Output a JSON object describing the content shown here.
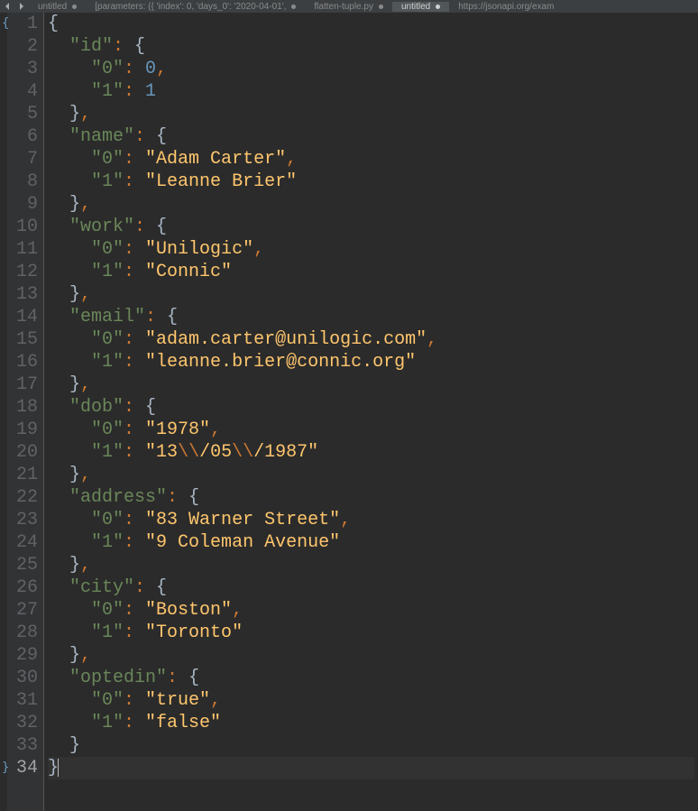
{
  "tabs": [
    {
      "label": "untitled",
      "modified": true,
      "active": false
    },
    {
      "label": "[parameters: ({ 'index': 0, 'days_0': '2020-04-01',",
      "modified": true,
      "active": false
    },
    {
      "label": "flatten-tuple.py",
      "modified": true,
      "active": false
    },
    {
      "label": "untitled",
      "modified": true,
      "active": true
    },
    {
      "label": "https://jsonapi.org/exam",
      "modified": false,
      "active": false
    }
  ],
  "code": {
    "lines": [
      [
        [
          "brace",
          "{"
        ]
      ],
      [
        [
          "sp",
          "  "
        ],
        [
          "key",
          "\"id\""
        ],
        [
          "punc",
          ": "
        ],
        [
          "brace",
          "{"
        ]
      ],
      [
        [
          "sp",
          "    "
        ],
        [
          "key",
          "\"0\""
        ],
        [
          "punc",
          ": "
        ],
        [
          "num",
          "0"
        ],
        [
          "punc",
          ","
        ]
      ],
      [
        [
          "sp",
          "    "
        ],
        [
          "key",
          "\"1\""
        ],
        [
          "punc",
          ": "
        ],
        [
          "num",
          "1"
        ]
      ],
      [
        [
          "sp",
          "  "
        ],
        [
          "brace",
          "}"
        ],
        [
          "punc",
          ","
        ]
      ],
      [
        [
          "sp",
          "  "
        ],
        [
          "key",
          "\"name\""
        ],
        [
          "punc",
          ": "
        ],
        [
          "brace",
          "{"
        ]
      ],
      [
        [
          "sp",
          "    "
        ],
        [
          "key",
          "\"0\""
        ],
        [
          "punc",
          ": "
        ],
        [
          "str",
          "\"Adam Carter\""
        ],
        [
          "punc",
          ","
        ]
      ],
      [
        [
          "sp",
          "    "
        ],
        [
          "key",
          "\"1\""
        ],
        [
          "punc",
          ": "
        ],
        [
          "str",
          "\"Leanne Brier\""
        ]
      ],
      [
        [
          "sp",
          "  "
        ],
        [
          "brace",
          "}"
        ],
        [
          "punc",
          ","
        ]
      ],
      [
        [
          "sp",
          "  "
        ],
        [
          "key",
          "\"work\""
        ],
        [
          "punc",
          ": "
        ],
        [
          "brace",
          "{"
        ]
      ],
      [
        [
          "sp",
          "    "
        ],
        [
          "key",
          "\"0\""
        ],
        [
          "punc",
          ": "
        ],
        [
          "str",
          "\"Unilogic\""
        ],
        [
          "punc",
          ","
        ]
      ],
      [
        [
          "sp",
          "    "
        ],
        [
          "key",
          "\"1\""
        ],
        [
          "punc",
          ": "
        ],
        [
          "str",
          "\"Connic\""
        ]
      ],
      [
        [
          "sp",
          "  "
        ],
        [
          "brace",
          "}"
        ],
        [
          "punc",
          ","
        ]
      ],
      [
        [
          "sp",
          "  "
        ],
        [
          "key",
          "\"email\""
        ],
        [
          "punc",
          ": "
        ],
        [
          "brace",
          "{"
        ]
      ],
      [
        [
          "sp",
          "    "
        ],
        [
          "key",
          "\"0\""
        ],
        [
          "punc",
          ": "
        ],
        [
          "str",
          "\"adam.carter@unilogic.com\""
        ],
        [
          "punc",
          ","
        ]
      ],
      [
        [
          "sp",
          "    "
        ],
        [
          "key",
          "\"1\""
        ],
        [
          "punc",
          ": "
        ],
        [
          "str",
          "\"leanne.brier@connic.org\""
        ]
      ],
      [
        [
          "sp",
          "  "
        ],
        [
          "brace",
          "}"
        ],
        [
          "punc",
          ","
        ]
      ],
      [
        [
          "sp",
          "  "
        ],
        [
          "key",
          "\"dob\""
        ],
        [
          "punc",
          ": "
        ],
        [
          "brace",
          "{"
        ]
      ],
      [
        [
          "sp",
          "    "
        ],
        [
          "key",
          "\"0\""
        ],
        [
          "punc",
          ": "
        ],
        [
          "str",
          "\"1978\""
        ],
        [
          "punc",
          ","
        ]
      ],
      [
        [
          "sp",
          "    "
        ],
        [
          "key",
          "\"1\""
        ],
        [
          "punc",
          ": "
        ],
        [
          "str",
          "\"13"
        ],
        [
          "esc",
          "\\\\"
        ],
        [
          "str",
          "/05"
        ],
        [
          "esc",
          "\\\\"
        ],
        [
          "str",
          "/1987\""
        ]
      ],
      [
        [
          "sp",
          "  "
        ],
        [
          "brace",
          "}"
        ],
        [
          "punc",
          ","
        ]
      ],
      [
        [
          "sp",
          "  "
        ],
        [
          "key",
          "\"address\""
        ],
        [
          "punc",
          ": "
        ],
        [
          "brace",
          "{"
        ]
      ],
      [
        [
          "sp",
          "    "
        ],
        [
          "key",
          "\"0\""
        ],
        [
          "punc",
          ": "
        ],
        [
          "str",
          "\"83 Warner Street\""
        ],
        [
          "punc",
          ","
        ]
      ],
      [
        [
          "sp",
          "    "
        ],
        [
          "key",
          "\"1\""
        ],
        [
          "punc",
          ": "
        ],
        [
          "str",
          "\"9 Coleman Avenue\""
        ]
      ],
      [
        [
          "sp",
          "  "
        ],
        [
          "brace",
          "}"
        ],
        [
          "punc",
          ","
        ]
      ],
      [
        [
          "sp",
          "  "
        ],
        [
          "key",
          "\"city\""
        ],
        [
          "punc",
          ": "
        ],
        [
          "brace",
          "{"
        ]
      ],
      [
        [
          "sp",
          "    "
        ],
        [
          "key",
          "\"0\""
        ],
        [
          "punc",
          ": "
        ],
        [
          "str",
          "\"Boston\""
        ],
        [
          "punc",
          ","
        ]
      ],
      [
        [
          "sp",
          "    "
        ],
        [
          "key",
          "\"1\""
        ],
        [
          "punc",
          ": "
        ],
        [
          "str",
          "\"Toronto\""
        ]
      ],
      [
        [
          "sp",
          "  "
        ],
        [
          "brace",
          "}"
        ],
        [
          "punc",
          ","
        ]
      ],
      [
        [
          "sp",
          "  "
        ],
        [
          "key",
          "\"optedin\""
        ],
        [
          "punc",
          ": "
        ],
        [
          "brace",
          "{"
        ]
      ],
      [
        [
          "sp",
          "    "
        ],
        [
          "key",
          "\"0\""
        ],
        [
          "punc",
          ": "
        ],
        [
          "str",
          "\"true\""
        ],
        [
          "punc",
          ","
        ]
      ],
      [
        [
          "sp",
          "    "
        ],
        [
          "key",
          "\"1\""
        ],
        [
          "punc",
          ": "
        ],
        [
          "str",
          "\"false\""
        ]
      ],
      [
        [
          "sp",
          "  "
        ],
        [
          "brace",
          "}"
        ]
      ],
      [
        [
          "brace",
          "}"
        ]
      ]
    ],
    "current_line": 34,
    "fold_open_line": 1,
    "fold_close_line": 34
  }
}
